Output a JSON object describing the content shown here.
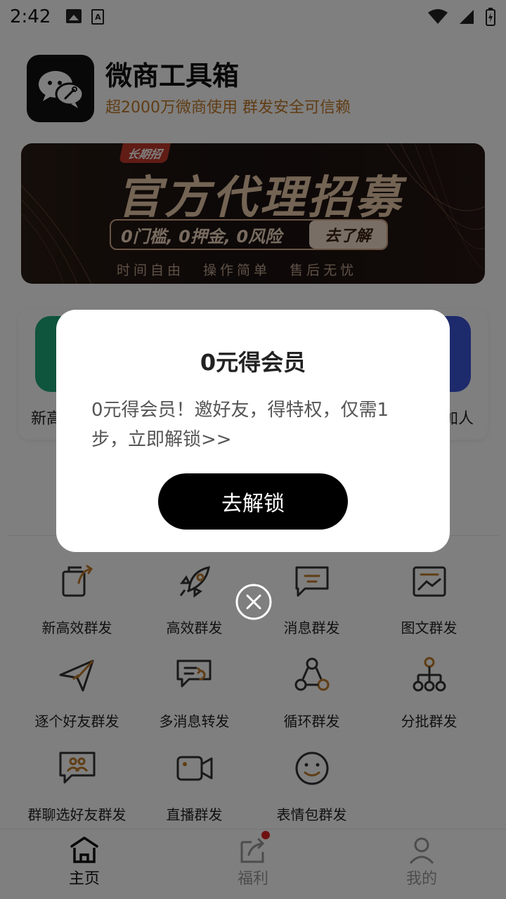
{
  "status_bar": {
    "time": "2:42"
  },
  "header": {
    "title": "微商工具箱",
    "subtitle": "超2000万微商使用 群发安全可信赖"
  },
  "banner": {
    "tag": "长期招",
    "title": "官方代理招募",
    "pill_text": "0门槛, 0押金, 0风险",
    "pill_button": "去了解",
    "slogan": "时间自由 操作简单 售后无忧"
  },
  "quick_card": {
    "left_label": "新高",
    "right_label": "加人"
  },
  "grid": {
    "items": [
      {
        "label": "新高效群发",
        "icon": "copy-share-icon"
      },
      {
        "label": "高效群发",
        "icon": "rocket-icon"
      },
      {
        "label": "消息群发",
        "icon": "message-icon"
      },
      {
        "label": "图文群发",
        "icon": "image-icon"
      },
      {
        "label": "逐个好友群发",
        "icon": "paper-plane-icon"
      },
      {
        "label": "多消息转发",
        "icon": "message-forward-icon"
      },
      {
        "label": "循环群发",
        "icon": "cycle-icon"
      },
      {
        "label": "分批群发",
        "icon": "batch-tree-icon"
      },
      {
        "label": "群聊选好友群发",
        "icon": "group-chat-icon"
      },
      {
        "label": "直播群发",
        "icon": "video-camera-icon"
      },
      {
        "label": "表情包群发",
        "icon": "smiley-icon"
      }
    ]
  },
  "bottom_nav": {
    "items": [
      {
        "label": "主页",
        "icon": "home-icon",
        "active": true
      },
      {
        "label": "福利",
        "icon": "share-icon",
        "active": false
      },
      {
        "label": "我的",
        "icon": "profile-icon",
        "active": false
      }
    ]
  },
  "dialog": {
    "title": "0元得会员",
    "body": "0元得会员！邀好友，得特权，仅需1步，立即解锁>>",
    "button": "去解锁"
  },
  "colors": {
    "accent": "#c07a2a",
    "dialog_button": "#000000",
    "badge": "#e02020"
  }
}
